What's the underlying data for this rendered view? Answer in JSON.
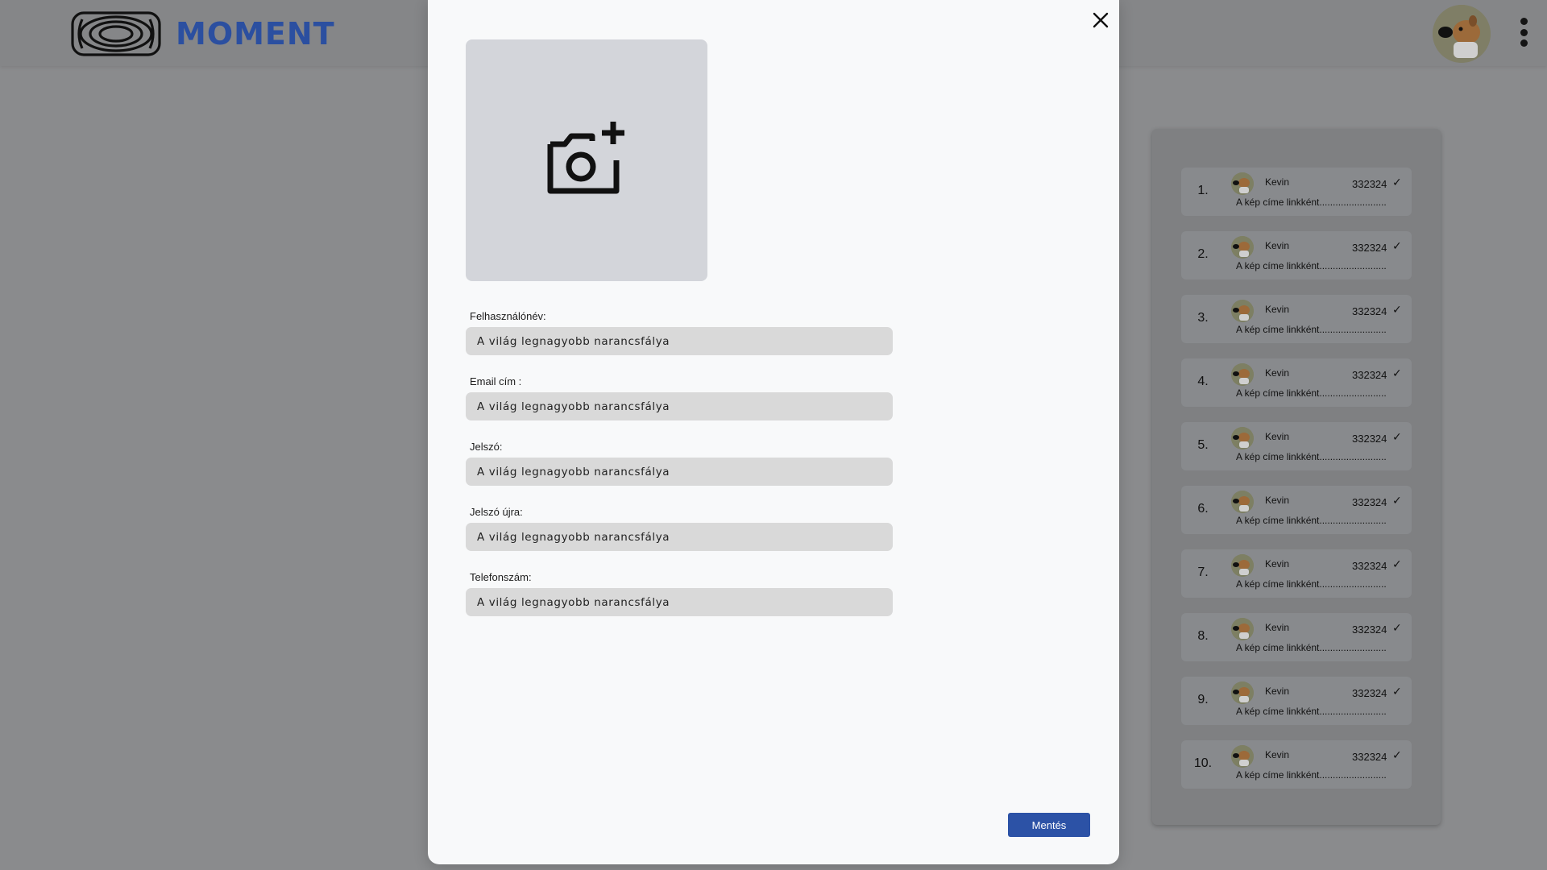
{
  "app": {
    "brand": "MOMENT"
  },
  "modal": {
    "fields": [
      {
        "label": "Felhasználónév:",
        "value": "A világ legnagyobb narancsfálya"
      },
      {
        "label": "Email cím :",
        "value": "A világ legnagyobb narancsfálya"
      },
      {
        "label": "Jelszó:",
        "value": "A világ legnagyobb narancsfálya"
      },
      {
        "label": "Jelszó újra:",
        "value": "A világ legnagyobb narancsfálya"
      },
      {
        "label": "Telefonszám:",
        "value": "A világ legnagyobb narancsfálya"
      }
    ],
    "save_label": "Mentés",
    "icons": {
      "close": "close-icon",
      "upload": "add-photo-icon"
    }
  },
  "leaderboard": {
    "items": [
      {
        "rank": "1.",
        "name": "Kevin",
        "score": "332324",
        "title": "A kép címe linkként........................."
      },
      {
        "rank": "2.",
        "name": "Kevin",
        "score": "332324",
        "title": "A kép címe linkként........................."
      },
      {
        "rank": "3.",
        "name": "Kevin",
        "score": "332324",
        "title": "A kép címe linkként........................."
      },
      {
        "rank": "4.",
        "name": "Kevin",
        "score": "332324",
        "title": "A kép címe linkként........................."
      },
      {
        "rank": "5.",
        "name": "Kevin",
        "score": "332324",
        "title": "A kép címe linkként........................."
      },
      {
        "rank": "6.",
        "name": "Kevin",
        "score": "332324",
        "title": "A kép címe linkként........................."
      },
      {
        "rank": "7.",
        "name": "Kevin",
        "score": "332324",
        "title": "A kép címe linkként........................."
      },
      {
        "rank": "8.",
        "name": "Kevin",
        "score": "332324",
        "title": "A kép címe linkként........................."
      },
      {
        "rank": "9.",
        "name": "Kevin",
        "score": "332324",
        "title": "A kép címe linkként........................."
      },
      {
        "rank": "10.",
        "name": "Kevin",
        "score": "332324",
        "title": "A kép címe linkként........................."
      }
    ]
  },
  "colors": {
    "brand": "#2b4fa0",
    "save_button": "#2c52a6",
    "overlay": "#8a8b8d",
    "modal_bg": "#f8f9fa"
  }
}
